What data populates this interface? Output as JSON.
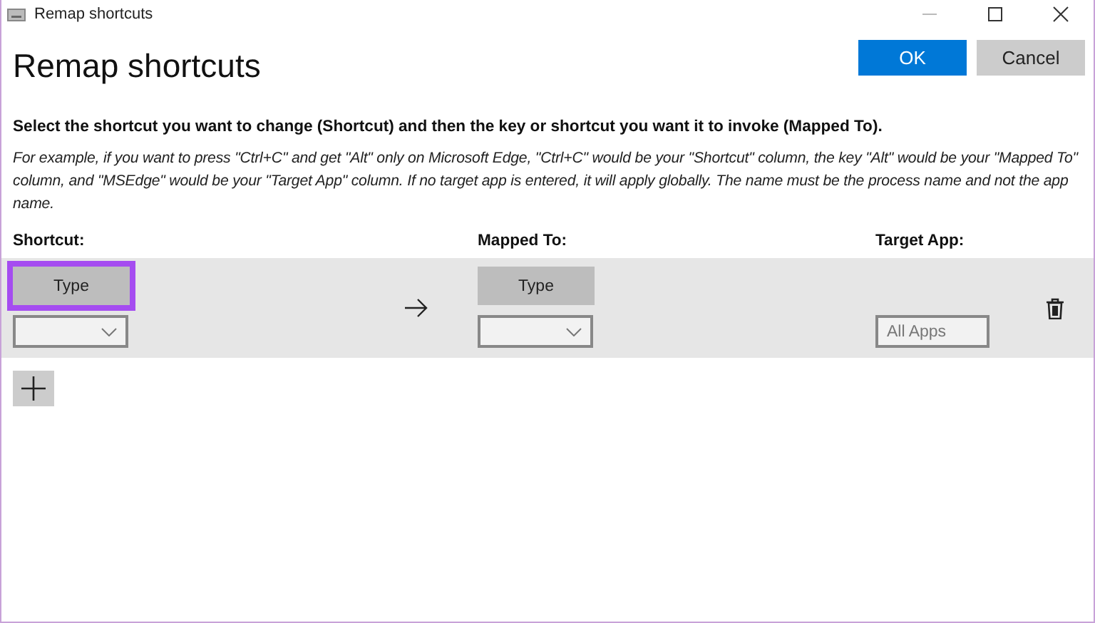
{
  "window": {
    "title": "Remap shortcuts"
  },
  "heading": "Remap shortcuts",
  "buttons": [
    {
      "label": "OK",
      "kind": "primary"
    },
    {
      "label": "Cancel",
      "kind": "secondary"
    }
  ],
  "instruction": "Select the shortcut you want to change (Shortcut) and then the key or shortcut you want it to invoke (Mapped To).",
  "example": "For example, if you want to press \"Ctrl+C\" and get \"Alt\" only on Microsoft Edge, \"Ctrl+C\" would be your \"Shortcut\" column, the key \"Alt\" would be your \"Mapped To\" column, and \"MSEdge\" would be your \"Target App\" column. If no target app is entered, it will apply globally. The name must be the process name and not the app name.",
  "columns": [
    "Shortcut:",
    "Mapped To:",
    "Target App:"
  ],
  "rows": [
    {
      "shortcut": {
        "button": "Type",
        "highlighted": true
      },
      "mapped_to": {
        "button": "Type",
        "highlighted": false
      },
      "target_app": {
        "placeholder": "All Apps"
      }
    }
  ]
}
